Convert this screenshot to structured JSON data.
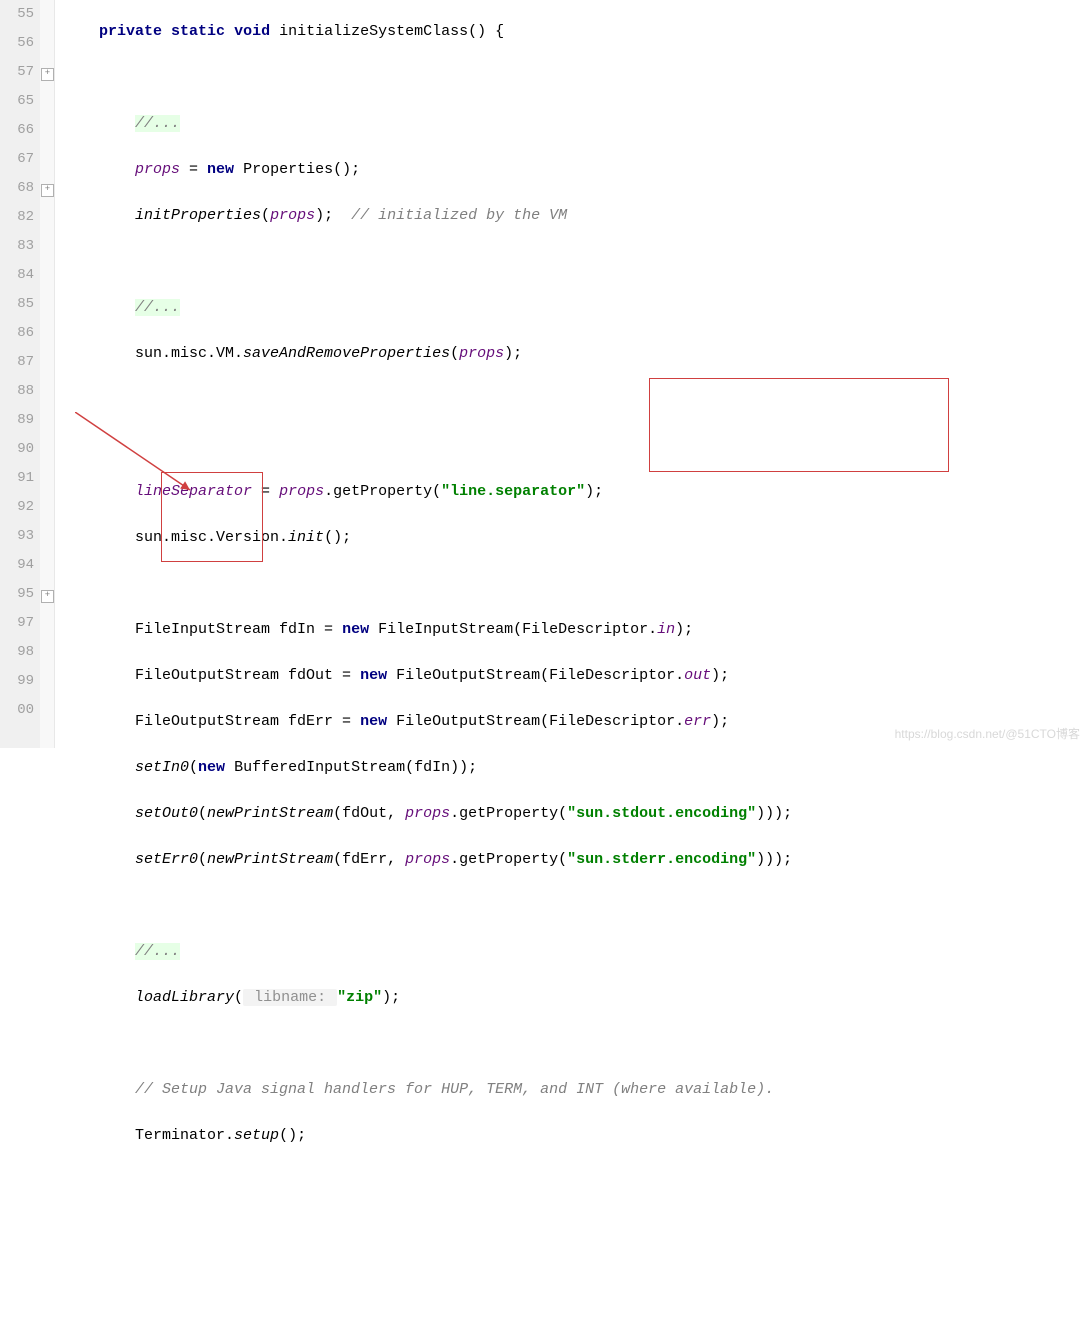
{
  "gutter": [
    "55",
    "56",
    "57",
    "65",
    "66",
    "67",
    "68",
    "82",
    "83",
    "84",
    "85",
    "86",
    "87",
    "88",
    "89",
    "90",
    "91",
    "92",
    "93",
    "94",
    "95",
    "97",
    "98",
    "99",
    "00",
    ""
  ],
  "code": {
    "l0_indent": "    ",
    "l0_kw1": "private",
    "l0_kw2": "static",
    "l0_kw3": "void",
    "l0_rest": " initializeSystemClass() {",
    "l1": "",
    "l2_indent": "        ",
    "l2_comment": "//...",
    "l3_indent": "        ",
    "l3_field": "props",
    "l3_mid": " = ",
    "l3_kw": "new",
    "l3_rest": " Properties();",
    "l4_indent": "        ",
    "l4_method": "initProperties",
    "l4_paren": "(",
    "l4_arg": "props",
    "l4_close": ");  ",
    "l4_comment": "// initialized by the VM",
    "l5": "",
    "l6_indent": "        ",
    "l6_comment": "//...",
    "l7_indent": "        ",
    "l7_a": "sun.misc.VM.",
    "l7_m": "saveAndRemoveProperties",
    "l7_b": "(",
    "l7_arg": "props",
    "l7_c": ");",
    "l8": "",
    "l9": "",
    "l10_indent": "        ",
    "l10_field": "lineSeparator",
    "l10_a": " = ",
    "l10_arg": "props",
    "l10_b": ".getProperty(",
    "l10_str": "\"line.separator\"",
    "l10_c": ");",
    "l11_indent": "        ",
    "l11_a": "sun.misc.Version.",
    "l11_m": "init",
    "l11_b": "();",
    "l12": "",
    "l13_indent": "        ",
    "l13_a": "FileInputStream fdIn = ",
    "l13_kw": "new",
    "l13_b": " FileInputStream(FileDescriptor.",
    "l13_f": "in",
    "l13_c": ");",
    "l14_indent": "        ",
    "l14_a": "FileOutputStream fdOut = ",
    "l14_kw": "new",
    "l14_b": " FileOutputStream(FileDescriptor.",
    "l14_f": "out",
    "l14_c": ");",
    "l15_indent": "        ",
    "l15_a": "FileOutputStream fdErr = ",
    "l15_kw": "new",
    "l15_b": " FileOutputStream(FileDescriptor.",
    "l15_f": "err",
    "l15_c": ");",
    "l16_indent": "        ",
    "l16_m": "setIn0",
    "l16_a": "(",
    "l16_kw": "new",
    "l16_b": " BufferedInputStream(fdIn));",
    "l17_indent": "        ",
    "l17_m": "setOut0",
    "l17_a": "(",
    "l17_m2": "newPrintStream",
    "l17_b": "(fdOut, ",
    "l17_arg": "props",
    "l17_c": ".getProperty(",
    "l17_str": "\"sun.stdout.encoding\"",
    "l17_d": ")));",
    "l18_indent": "        ",
    "l18_m": "setErr0",
    "l18_a": "(",
    "l18_m2": "newPrintStream",
    "l18_b": "(fdErr, ",
    "l18_arg": "props",
    "l18_c": ".getProperty(",
    "l18_str": "\"sun.stderr.encoding\"",
    "l18_d": ")));",
    "l19": "",
    "l20_indent": "        ",
    "l20_comment": "//...",
    "l21_indent": "        ",
    "l21_m": "loadLibrary",
    "l21_a": "(",
    "l21_hint": " libname: ",
    "l21_str": "\"zip\"",
    "l21_b": ");",
    "l22": "",
    "l23_indent": "        ",
    "l23_comment": "// Setup Java signal handlers for HUP, TERM, and INT (where available).",
    "l24_indent": "        ",
    "l24_a": "Terminator.",
    "l24_m": "setup",
    "l24_b": "();"
  },
  "watermark": "https://blog.csdn.net/@51CTO博客"
}
